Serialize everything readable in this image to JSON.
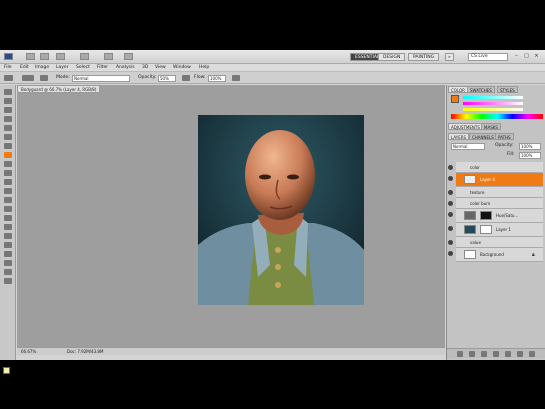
{
  "workspaces": [
    "ESSENTIALS",
    "DESIGN",
    "PAINTING"
  ],
  "active_workspace": "ESSENTIALS",
  "search_label": "CS Live",
  "menu": [
    "File",
    "Edit",
    "Image",
    "Layer",
    "Select",
    "Filter",
    "Analysis",
    "3D",
    "View",
    "Window",
    "Help"
  ],
  "options": {
    "mode_label": "Mode:",
    "mode_value": "Normal",
    "opacity_label": "Opacity:",
    "opacity_value": "50%",
    "flow_label": "Flow:",
    "flow_value": "100%"
  },
  "doc_tab": "Bodyguard @ 66.7% (Layer 4, RGB/8)",
  "status": {
    "zoom": "66.67%",
    "doc": "Doc: 7.92M/43.8M"
  },
  "panel_tabs": {
    "color": [
      "COLOR",
      "SWATCHES",
      "STYLES"
    ],
    "adjust": [
      "ADJUSTMENTS",
      "MASKS"
    ],
    "layers": [
      "LAYERS",
      "CHANNELS",
      "PATHS"
    ]
  },
  "layers_controls": {
    "blend": "Normal",
    "opacity_label": "Opacity:",
    "opacity": "100%",
    "fill_label": "Fill:",
    "fill": "100%"
  },
  "layers": [
    {
      "name": "color",
      "type": "group"
    },
    {
      "name": "Layer 4",
      "type": "layer",
      "selected": true
    },
    {
      "name": "texture",
      "type": "group"
    },
    {
      "name": "color burn",
      "type": "group"
    },
    {
      "name": "Hue/Satu...",
      "type": "adjustment"
    },
    {
      "name": "Layer 1",
      "type": "layer"
    },
    {
      "name": "value",
      "type": "group"
    },
    {
      "name": "Background",
      "type": "background"
    }
  ],
  "colors": {
    "accent": "#f07b14",
    "workspace_active": "#444444"
  }
}
